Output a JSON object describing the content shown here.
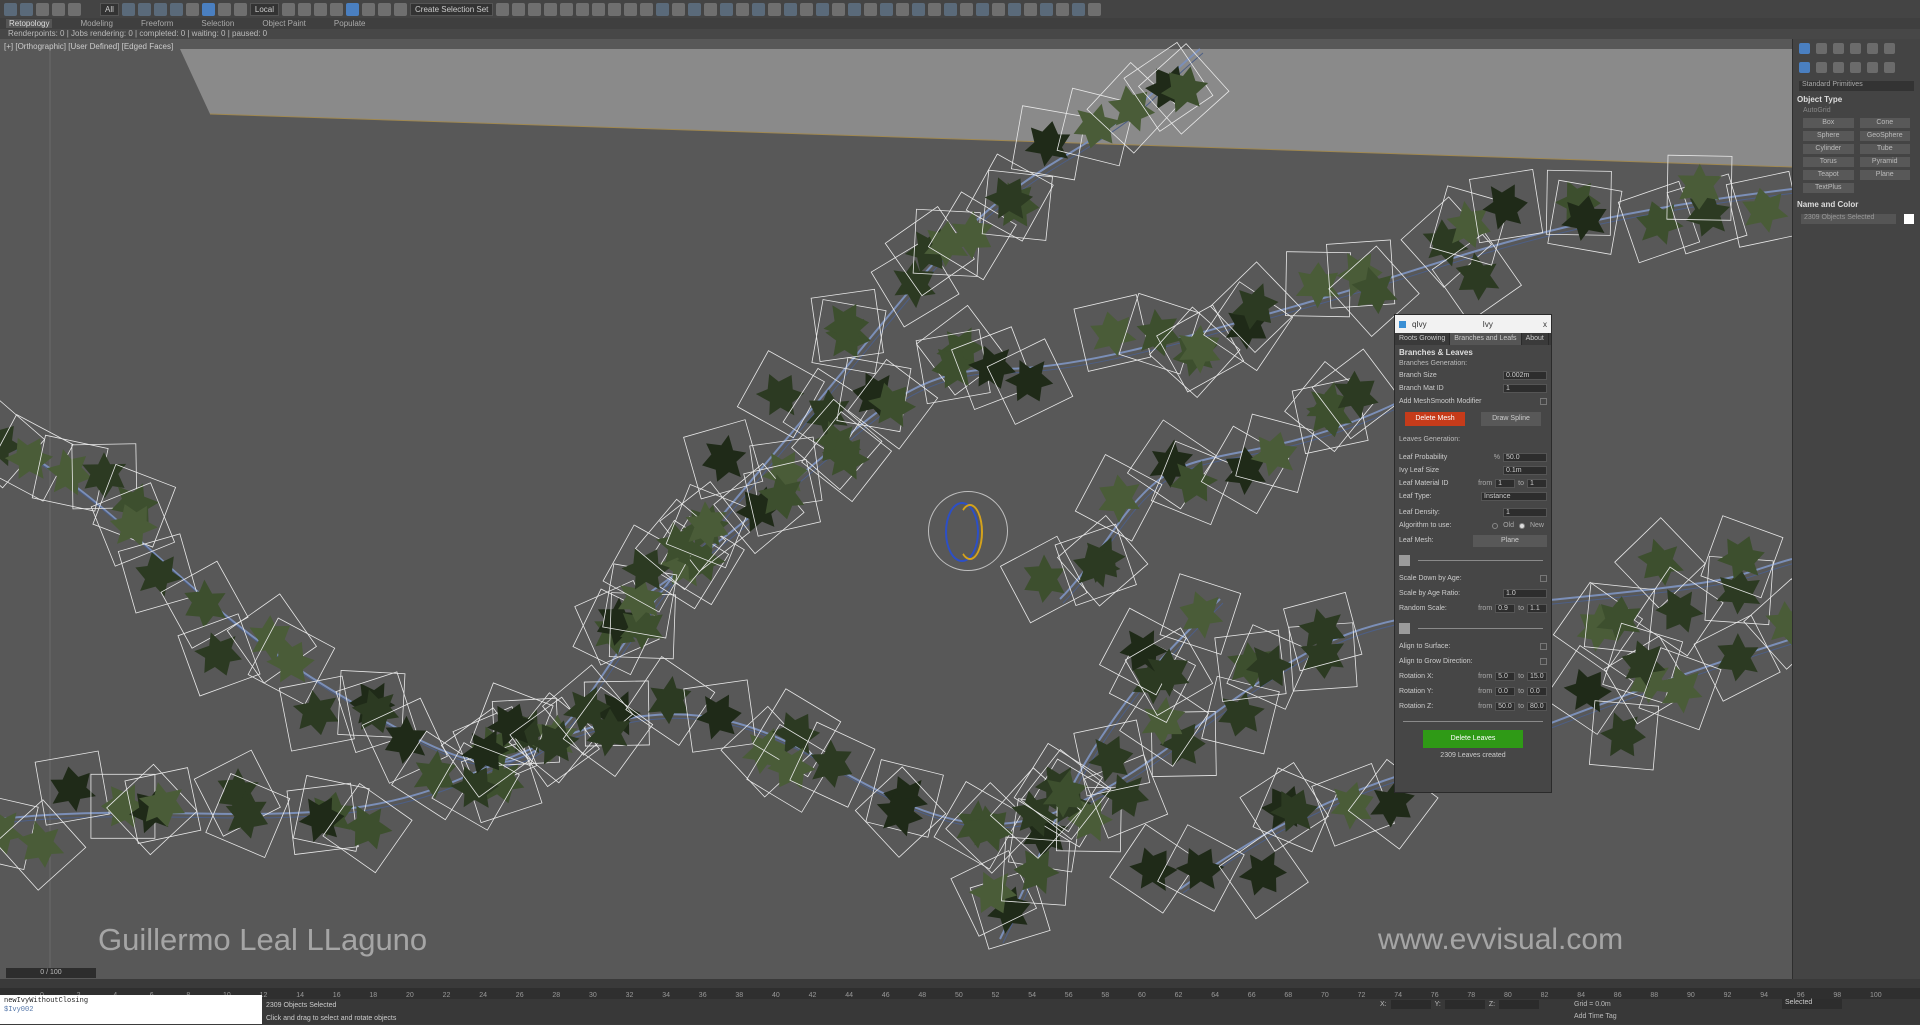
{
  "toolbar": {
    "filter": "All",
    "coord_system": "Local",
    "selection_set": "Create Selection Set"
  },
  "ribbon": {
    "tabs": [
      "Retopology",
      "Modeling",
      "Freeform",
      "Selection",
      "Object Paint",
      "Populate"
    ]
  },
  "status_line": "Renderpoints: 0 | Jobs rendering: 0 | completed: 0 | waiting: 0 | paused: 0",
  "viewport": {
    "label": "[+] [Orthographic] [User Defined] [Edged Faces]",
    "signature_left": "Guillermo Leal LLaguno",
    "signature_right": "www.evvisual.com"
  },
  "command_panel": {
    "category": "Standard Primitives",
    "object_type_title": "Object Type",
    "autogrid": "AutoGrid",
    "primitives": [
      "Box",
      "Cone",
      "Sphere",
      "GeoSphere",
      "Cylinder",
      "Tube",
      "Torus",
      "Pyramid",
      "Teapot",
      "Plane",
      "TextPlus"
    ],
    "name_color_title": "Name and Color",
    "name_value": "2309 Objects Selected",
    "colors": {
      "swatch": "#ffffff"
    }
  },
  "dialog": {
    "title": "qIvy",
    "title_right": "Ivy",
    "close": "x",
    "tabs": [
      "Roots Growing",
      "Branches and Leafs",
      "About"
    ],
    "section": "Branches & Leaves",
    "branches_generation": "Branches Generation:",
    "branch_size_label": "Branch Size",
    "branch_size_value": "0.002m",
    "branch_mat_label": "Branch Mat ID",
    "branch_mat_value": "1",
    "meshsmooth_label": "Add MeshSmooth Modifier",
    "delete_mesh": "Delete Mesh",
    "draw_spline": "Draw Spline",
    "leaves_generation": "Leaves Generation:",
    "leaf_probability_label": "Leaf Probability",
    "leaf_probability_unit": "%",
    "leaf_probability_value": "50.0",
    "ivy_leaf_size_label": "Ivy Leaf Size",
    "ivy_leaf_size_value": "0.1m",
    "leaf_material_label": "Leaf Material ID",
    "from": "from",
    "to": "to",
    "leaf_material_from": "1",
    "leaf_material_to": "1",
    "leaf_type_label": "Leaf Type:",
    "leaf_type_value": "Instance",
    "leaf_density_label": "Leaf Density:",
    "leaf_density_value": "1",
    "algorithm_label": "Algorithm to use:",
    "algorithm_old": "Old",
    "algorithm_new": "New",
    "leaf_mesh_label": "Leaf Mesh:",
    "leaf_mesh_value": "Plane",
    "scale_down_label": "Scale Down by Age:",
    "scale_ratio_label": "Scale by Age Ratio:",
    "scale_ratio_value": "1.0",
    "random_scale_label": "Random Scale:",
    "random_scale_from": "0.9",
    "random_scale_to": "1.1",
    "align_surface_label": "Align to Surface:",
    "align_grow_label": "Align to Grow Direction:",
    "rot_x_label": "Rotation X:",
    "rot_x_from": "5.0",
    "rot_x_to": "15.0",
    "rot_y_label": "Rotation Y:",
    "rot_y_from": "0.0",
    "rot_y_to": "0.0",
    "rot_z_label": "Rotation Z:",
    "rot_z_from": "50.0",
    "rot_z_to": "80.0",
    "delete_leaves": "Delete Leaves",
    "status": "2309 Leaves created"
  },
  "bottom": {
    "frame_counter": "0 / 100",
    "maxscript_line1": "newIvyWithoutClosing",
    "maxscript_line2": "$Ivy002",
    "status_selected": "2309 Objects Selected",
    "status_hint": "Click and drag to select and rotate objects",
    "x_label": "X:",
    "y_label": "Y:",
    "z_label": "Z:",
    "grid": "Grid = 0.0m",
    "add_time_tag": "Add Time Tag",
    "selected_dropdown": "Selected",
    "ticks": [
      "0",
      "2",
      "4",
      "6",
      "8",
      "10",
      "12",
      "14",
      "16",
      "18",
      "20",
      "22",
      "24",
      "26",
      "28",
      "30",
      "32",
      "34",
      "36",
      "38",
      "40",
      "42",
      "44",
      "46",
      "48",
      "50",
      "52",
      "54",
      "56",
      "58",
      "60",
      "62",
      "64",
      "66",
      "68",
      "70",
      "72",
      "74",
      "76",
      "78",
      "80",
      "82",
      "84",
      "86",
      "88",
      "90",
      "92",
      "94",
      "96",
      "98",
      "100"
    ]
  }
}
